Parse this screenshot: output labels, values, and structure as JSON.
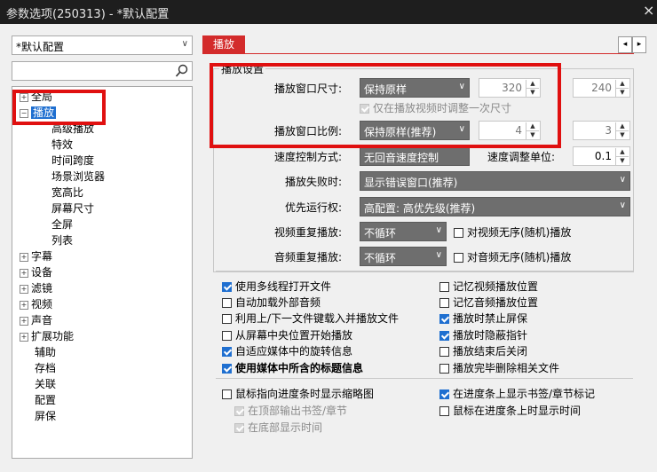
{
  "window": {
    "title": "参数选项(250313) - *默认配置",
    "close_glyph": "×"
  },
  "left": {
    "profile": "*默认配置",
    "search_placeholder": "",
    "tree": {
      "items": [
        {
          "label": "全局"
        },
        {
          "label": "播放"
        },
        {
          "label": "高级播放"
        },
        {
          "label": "特效"
        },
        {
          "label": "时间跨度"
        },
        {
          "label": "场景浏览器"
        },
        {
          "label": "宽高比"
        },
        {
          "label": "屏幕尺寸"
        },
        {
          "label": "全屏"
        },
        {
          "label": "列表"
        },
        {
          "label": "字幕"
        },
        {
          "label": "设备"
        },
        {
          "label": "滤镜"
        },
        {
          "label": "视频"
        },
        {
          "label": "声音"
        },
        {
          "label": "扩展功能"
        },
        {
          "label": "辅助"
        },
        {
          "label": "存档"
        },
        {
          "label": "关联"
        },
        {
          "label": "配置"
        },
        {
          "label": "屏保"
        }
      ]
    }
  },
  "right": {
    "tab": "播放",
    "nav": {
      "prev": "◂",
      "next": "▸"
    },
    "group_title": "播放设置",
    "window_size": {
      "label": "播放窗口尺寸:",
      "value": "保持原样",
      "w": "320",
      "h": "240"
    },
    "adjust_once": "仅在播放视频时调整一次尺寸",
    "window_ratio": {
      "label": "播放窗口比例:",
      "value": "保持原样(推荐)",
      "w": "4",
      "h": "3"
    },
    "speed_mode": {
      "label": "速度控制方式:",
      "value": "无回音速度控制"
    },
    "speed_unit": {
      "label": "速度调整单位:",
      "value": "0.1"
    },
    "on_fail": {
      "label": "播放失败时:",
      "value": "显示错误窗口(推荐)"
    },
    "priority": {
      "label": "优先运行权:",
      "value": "高配置: 高优先级(推荐)"
    },
    "video_repeat": {
      "label": "视频重复播放:",
      "value": "不循环",
      "random": "对视频无序(随机)播放"
    },
    "audio_repeat": {
      "label": "音频重复播放:",
      "value": "不循环",
      "random": "对音频无序(随机)播放"
    },
    "checks_left": [
      {
        "label": "使用多线程打开文件",
        "checked": true
      },
      {
        "label": "自动加载外部音频",
        "checked": false
      },
      {
        "label": "利用上/下一文件键载入并播放文件",
        "checked": false
      },
      {
        "label": "从屏幕中央位置开始播放",
        "checked": false
      },
      {
        "label": "自适应媒体中的旋转信息",
        "checked": true
      },
      {
        "label": "使用媒体中所含的标题信息",
        "checked": true
      }
    ],
    "checks_right": [
      {
        "label": "记忆视频播放位置",
        "checked": false
      },
      {
        "label": "记忆音频播放位置",
        "checked": false
      },
      {
        "label": "播放时禁止屏保",
        "checked": true
      },
      {
        "label": "播放时隐蔽指针",
        "checked": true
      },
      {
        "label": "播放结束后关闭",
        "checked": false
      },
      {
        "label": "播放完毕删除相关文件",
        "checked": false
      }
    ],
    "thumb": {
      "label": "鼠标指向进度条时显示缩略图",
      "checked": false
    },
    "top_bookmark": "在顶部输出书签/章节",
    "bottom_time": "在底部显示时间",
    "bar_marks": {
      "label": "在进度条上显示书签/章节标记",
      "checked": true
    },
    "bar_time": {
      "label": "鼠标在进度条上时显示时间",
      "checked": false
    }
  },
  "colors": {
    "tab_bg": "#d32b2b",
    "accent": "#1f6fd0",
    "highlight": "#e01010"
  }
}
